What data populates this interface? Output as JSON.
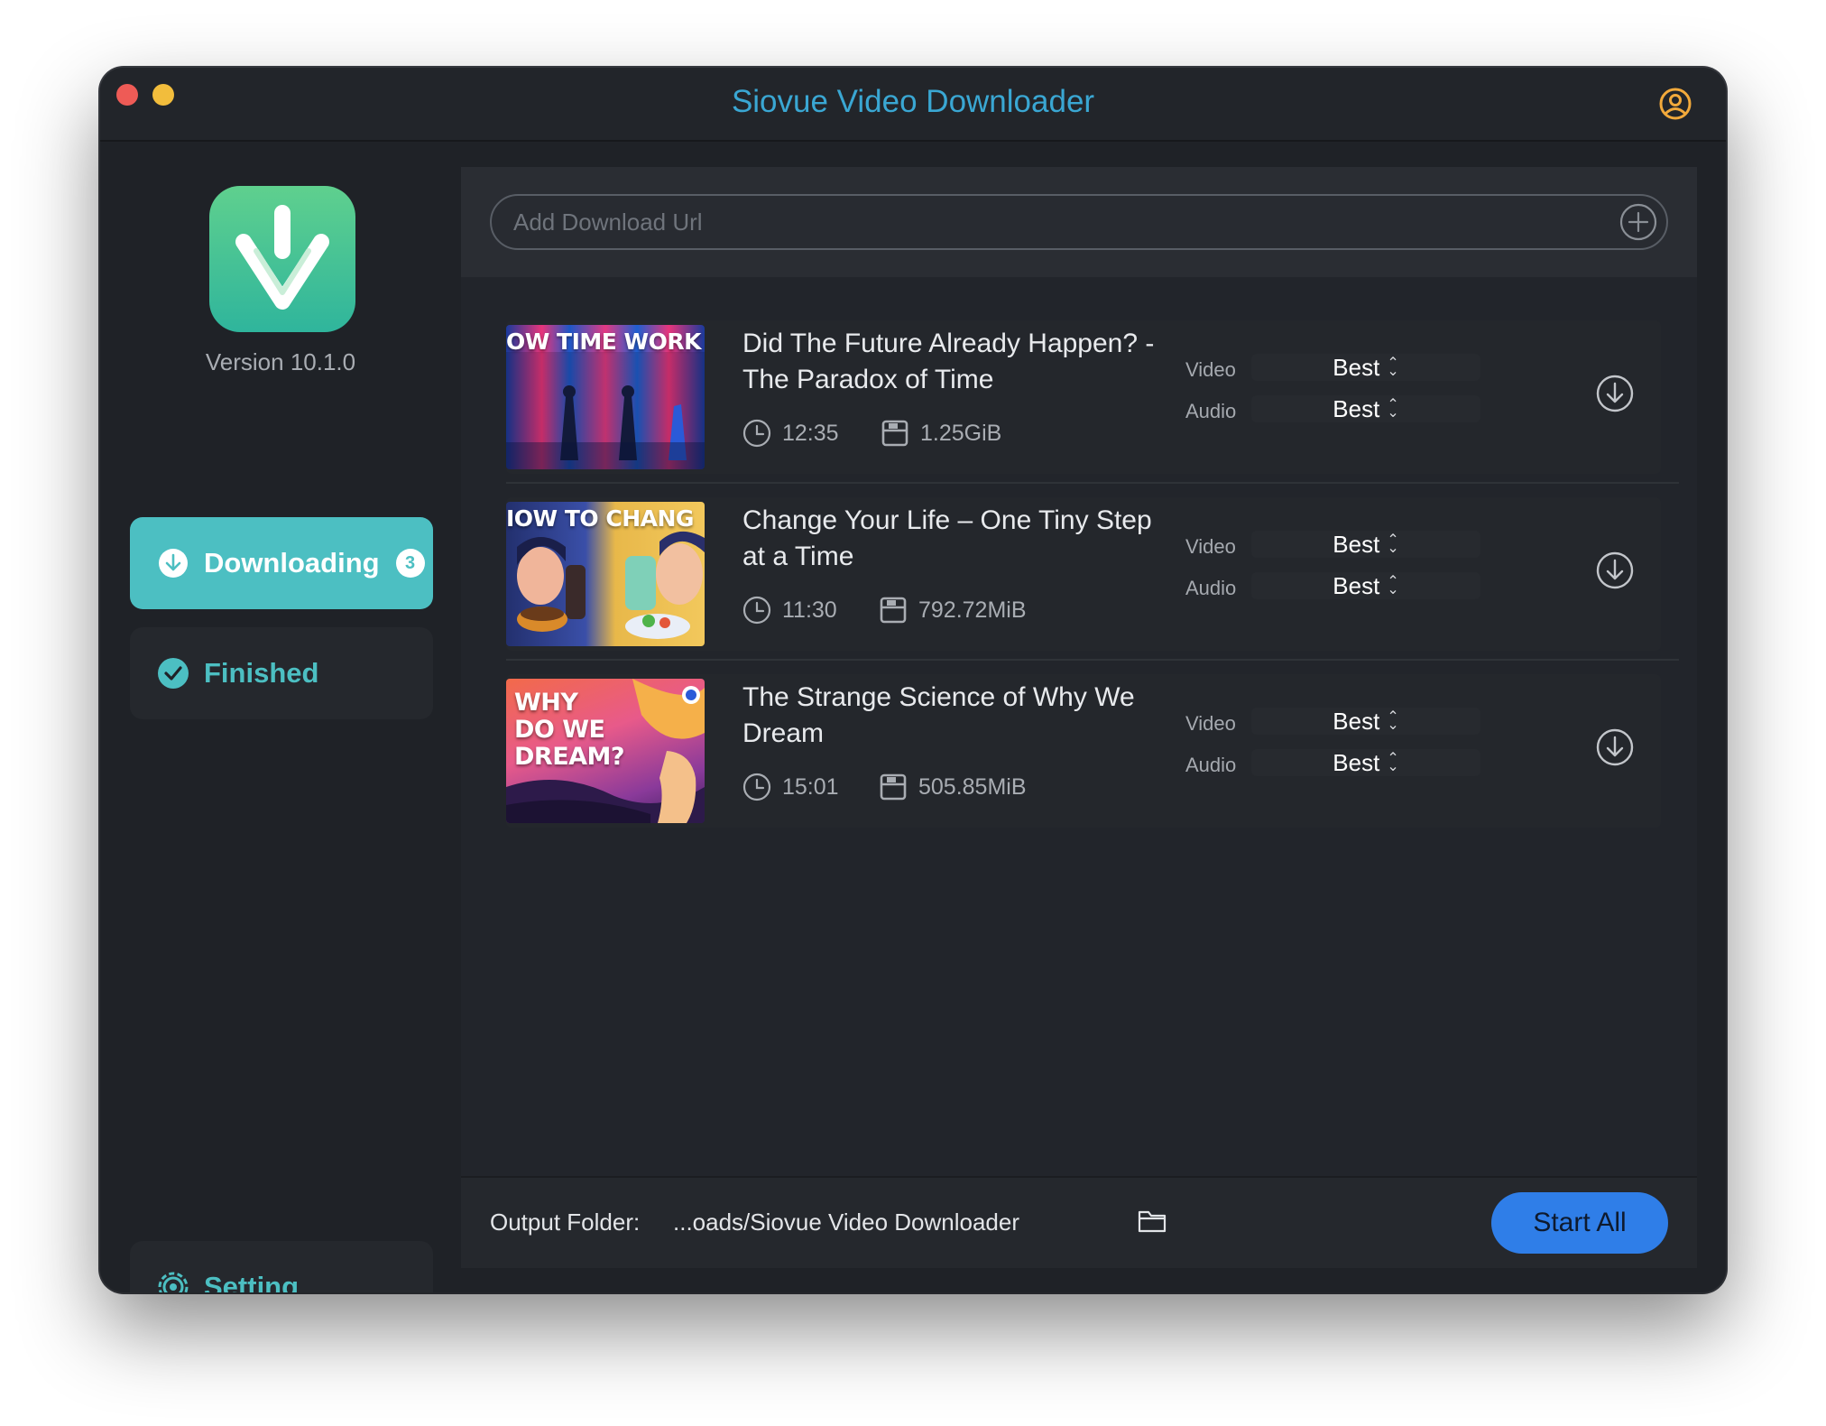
{
  "window": {
    "title": "Siovue Video Downloader"
  },
  "sidebar": {
    "version": "Version 10.1.0",
    "nav": {
      "downloading": {
        "label": "Downloading",
        "badge": "3"
      },
      "finished": {
        "label": "Finished"
      },
      "setting": {
        "label": "Setting"
      }
    }
  },
  "url_bar": {
    "placeholder": "Add Download Url",
    "value": ""
  },
  "downloads": [
    {
      "thumbnail_text": "OW TIME WORK",
      "title": "Did The Future Already Happen? - The Paradox of Time",
      "duration": "12:35",
      "size": "1.25GiB",
      "video_label": "Video",
      "video_quality": "Best",
      "audio_label": "Audio",
      "audio_quality": "Best"
    },
    {
      "thumbnail_text": "IOW TO CHANG",
      "title": "Change Your Life – One Tiny Step at a Time",
      "duration": "11:30",
      "size": "792.72MiB",
      "video_label": "Video",
      "video_quality": "Best",
      "audio_label": "Audio",
      "audio_quality": "Best"
    },
    {
      "thumbnail_text": "WHY\nDO WE\nDREAM?",
      "title": "The Strange Science of Why We Dream",
      "duration": "15:01",
      "size": "505.85MiB",
      "video_label": "Video",
      "video_quality": "Best",
      "audio_label": "Audio",
      "audio_quality": "Best"
    }
  ],
  "footer": {
    "output_label": "Output Folder:",
    "output_path": "...oads/Siovue Video Downloader",
    "start_all": "Start All"
  },
  "icons": {
    "account": "user-circle-icon",
    "add": "plus-circle-icon",
    "duration": "clock-icon",
    "size": "disk-icon",
    "download": "download-circle-icon",
    "folder": "folder-icon",
    "setting": "gear-icon",
    "finished": "check-circle-icon"
  },
  "colors": {
    "accent_teal": "#4cbfc2",
    "title_blue": "#3aa7d3",
    "start_blue": "#2f7ee8",
    "account_orange": "#f2a93b",
    "window_bg": "#1f2227"
  }
}
